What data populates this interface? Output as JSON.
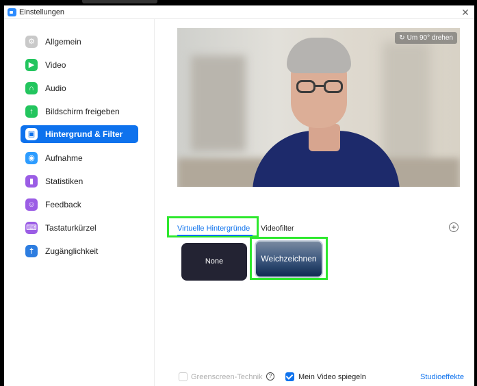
{
  "window": {
    "title": "Einstellungen",
    "close_glyph": "✕"
  },
  "colors": {
    "accent": "#0e72ed",
    "highlight": "#2ee82e"
  },
  "sidebar": {
    "items": [
      {
        "label": "Allgemein",
        "icon": "gear-icon",
        "color": "#c9c9c9"
      },
      {
        "label": "Video",
        "icon": "video-camera-icon",
        "color": "#23c55e"
      },
      {
        "label": "Audio",
        "icon": "headphones-icon",
        "color": "#23c55e"
      },
      {
        "label": "Bildschirm freigeben",
        "icon": "share-screen-icon",
        "color": "#23c55e"
      },
      {
        "label": "Hintergrund & Filter",
        "icon": "background-icon",
        "color": "#0e72ed",
        "active": true
      },
      {
        "label": "Aufnahme",
        "icon": "record-icon",
        "color": "#2d9cff"
      },
      {
        "label": "Statistiken",
        "icon": "statistics-icon",
        "color": "#9b5de5"
      },
      {
        "label": "Feedback",
        "icon": "feedback-icon",
        "color": "#9b5de5"
      },
      {
        "label": "Tastaturkürzel",
        "icon": "keyboard-icon",
        "color": "#9b5de5"
      },
      {
        "label": "Zugänglichkeit",
        "icon": "accessibility-icon",
        "color": "#2d7de0"
      }
    ]
  },
  "preview": {
    "rotate_label": "Um 90° drehen"
  },
  "tabs": {
    "virtual": "Virtuelle Hintergründe",
    "filter": "Videofilter",
    "add_glyph": "+"
  },
  "backgrounds": {
    "none": "None",
    "blur": "Weichzeichnen"
  },
  "bottom": {
    "greenscreen": "Greenscreen-Technik",
    "greenscreen_checked": false,
    "help_glyph": "?",
    "mirror": "Mein Video spiegeln",
    "mirror_checked": true,
    "studio": "Studioeffekte"
  }
}
